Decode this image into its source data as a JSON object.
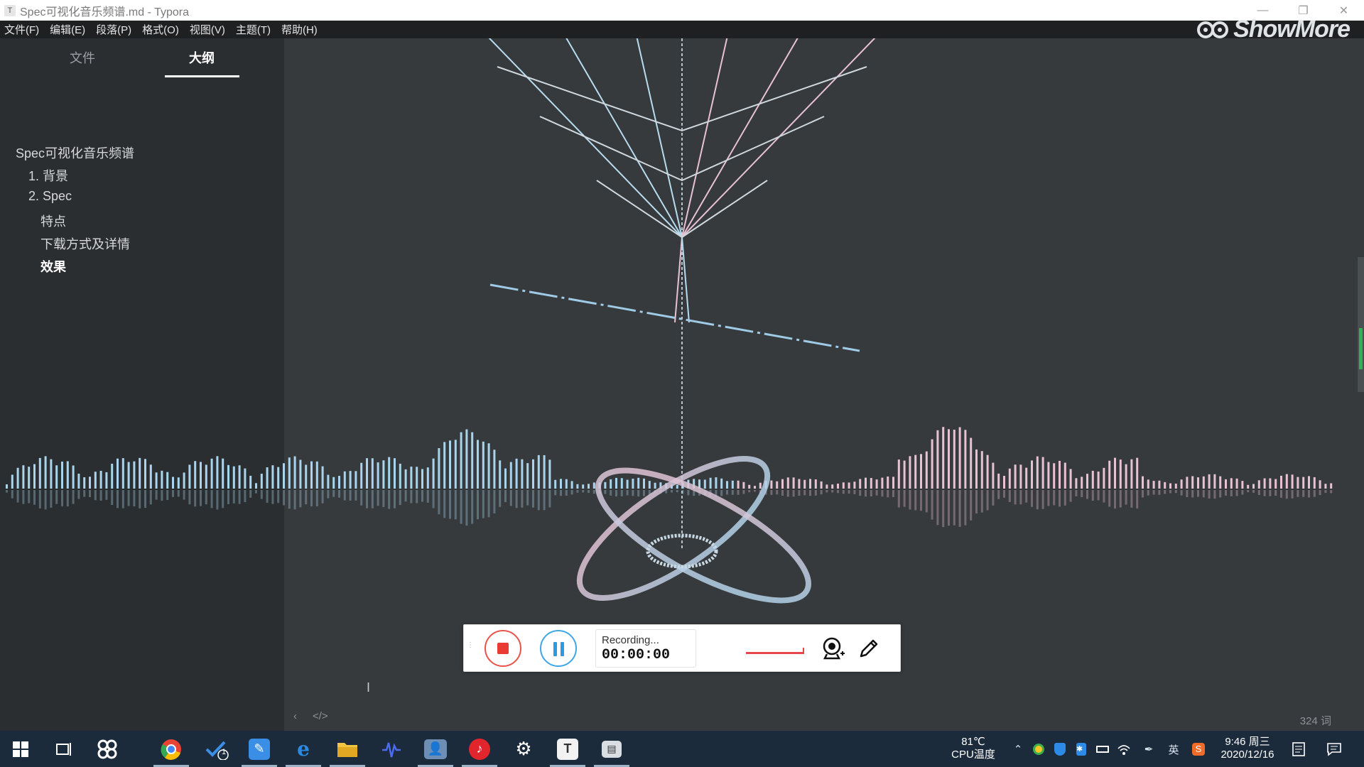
{
  "window": {
    "title": "Spec可视化音乐频谱.md - Typora",
    "app_icon": "T",
    "min": "—",
    "restore": "❐",
    "close": "✕"
  },
  "menu": [
    "文件(F)",
    "编辑(E)",
    "段落(P)",
    "格式(O)",
    "视图(V)",
    "主题(T)",
    "帮助(H)"
  ],
  "sidebar": {
    "tabs": {
      "file": "文件",
      "outline": "大纲",
      "active": "outline"
    },
    "outline": [
      {
        "label": "Spec可视化音乐频谱",
        "level": 1
      },
      {
        "label": "1. 背景",
        "level": 2
      },
      {
        "label": "2. Spec",
        "level": 2
      },
      {
        "label": "特点",
        "level": 3
      },
      {
        "label": "下载方式及详情",
        "level": 3
      },
      {
        "label": "效果",
        "level": 3,
        "bold": true
      }
    ]
  },
  "watermark": {
    "text": "ShowMore",
    "icon": "camera-owl-icon"
  },
  "recorder": {
    "status": "Recording...",
    "time": "00:00:00",
    "icons": [
      "stop-icon",
      "pause-icon",
      "webcam-icon",
      "pencil-icon"
    ]
  },
  "editor_footer": {
    "back": "‹",
    "source": "</>",
    "word_count": "324 词"
  },
  "taskbar": {
    "apps": [
      "start-icon",
      "task-view-icon",
      "app-icon",
      "chrome-icon",
      "todo-icon",
      "feishu-icon",
      "edge-icon",
      "file-explorer-icon",
      "audio-icon",
      "photo-app-icon",
      "netease-music-icon",
      "settings-icon",
      "typora-icon",
      "showmore-icon"
    ],
    "todo_badge": "1",
    "cpu_temp": "81℃",
    "cpu_label": "CPU温度",
    "ime": "英",
    "time": "9:46 周三",
    "date": "2020/12/16"
  },
  "colors": {
    "accent_blue": "#2e9be0",
    "record_red": "#ea3b33",
    "bar_blue": "#a9d4ec",
    "bar_pink": "#e7c2d2"
  }
}
